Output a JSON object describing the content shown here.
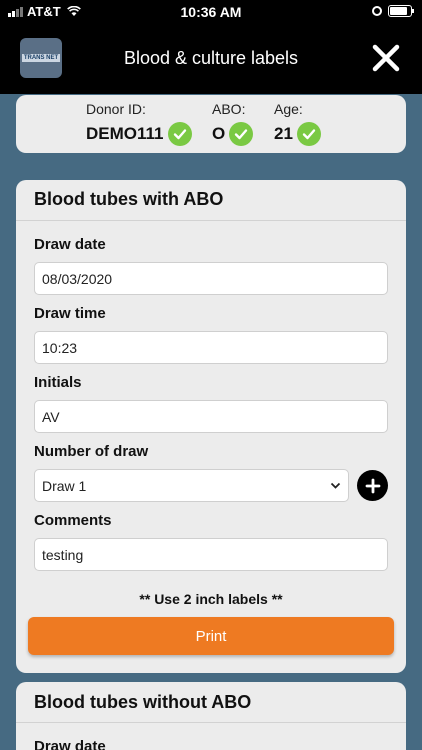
{
  "status_bar": {
    "carrier": "AT&T",
    "time": "10:36 AM"
  },
  "header": {
    "title": "Blood & culture labels",
    "logo_text": "TRANS NET"
  },
  "donor": {
    "donor_id_label": "Donor ID:",
    "donor_id": "DEMO111",
    "abo_label": "ABO:",
    "abo": "O",
    "age_label": "Age:",
    "age": "21"
  },
  "card_with_abo": {
    "title": "Blood tubes with ABO",
    "draw_date_label": "Draw date",
    "draw_date": "08/03/2020",
    "draw_time_label": "Draw time",
    "draw_time": "10:23",
    "initials_label": "Initials",
    "initials": "AV",
    "number_of_draw_label": "Number of draw",
    "number_of_draw": "Draw 1",
    "comments_label": "Comments",
    "comments": "testing",
    "note": "** Use 2 inch labels **",
    "print_label": "Print"
  },
  "card_without_abo": {
    "title": "Blood tubes without ABO",
    "draw_date_label": "Draw date"
  },
  "colors": {
    "accent": "#ee7a22",
    "check": "#7ac943",
    "background": "#466a82"
  }
}
